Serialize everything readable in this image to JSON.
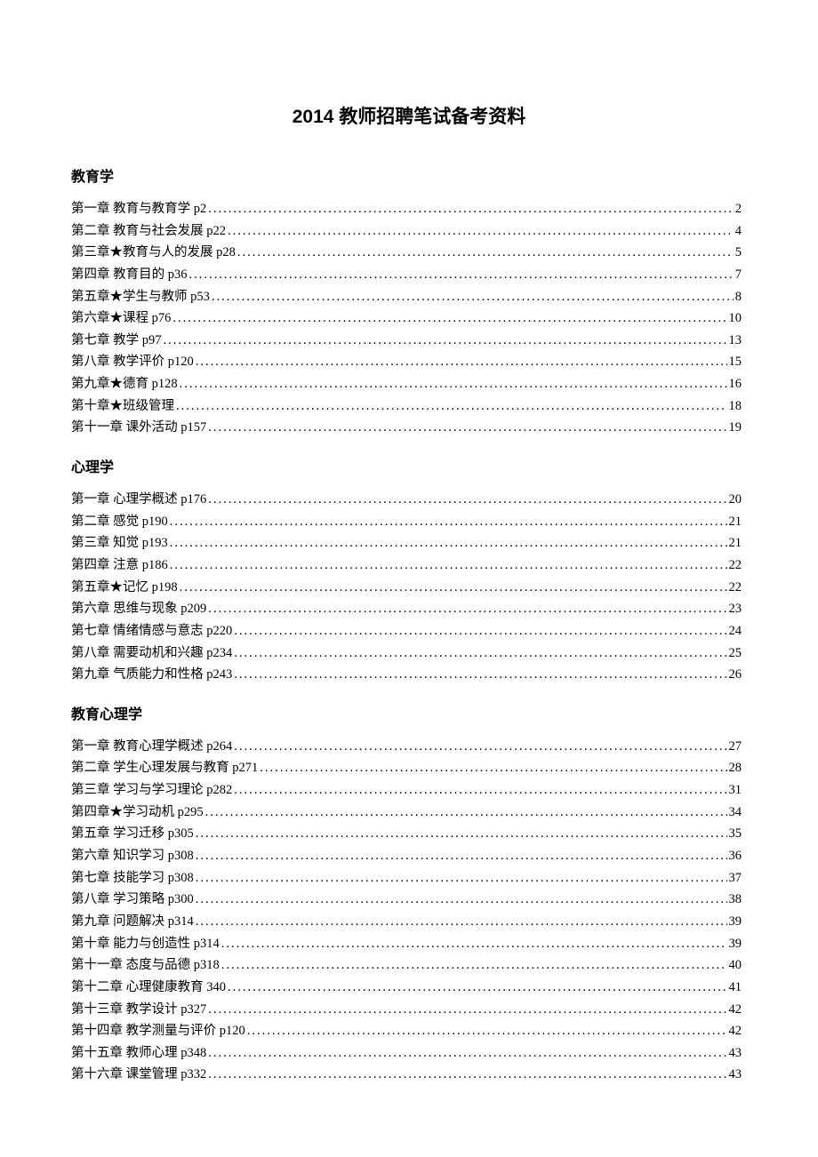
{
  "title": "2014 教师招聘笔试备考资料",
  "sections": [
    {
      "heading": "教育学",
      "items": [
        {
          "label": "第一章  教育与教育学 p2",
          "page": "2"
        },
        {
          "label": "第二章  教育与社会发展 p22",
          "page": "4"
        },
        {
          "label": "第三章★教育与人的发展 p28",
          "page": "5"
        },
        {
          "label": "第四章  教育目的 p36",
          "page": "7"
        },
        {
          "label": "第五章★学生与教师 p53",
          "page": "8"
        },
        {
          "label": "第六章★课程 p76",
          "page": "10"
        },
        {
          "label": "第七章  教学 p97",
          "page": "13"
        },
        {
          "label": "第八章  教学评价 p120",
          "page": "15"
        },
        {
          "label": "第九章★德育 p128",
          "page": "16"
        },
        {
          "label": "第十章★班级管理",
          "page": "18"
        },
        {
          "label": "第十一章  课外活动 p157",
          "page": "19"
        }
      ]
    },
    {
      "heading": "心理学",
      "items": [
        {
          "label": "第一章  心理学概述 p176",
          "page": "20"
        },
        {
          "label": "第二章  感觉 p190",
          "page": "21"
        },
        {
          "label": "第三章  知觉 p193",
          "page": "21"
        },
        {
          "label": "第四章  注意 p186",
          "page": "22"
        },
        {
          "label": "第五章★记忆 p198",
          "page": "22"
        },
        {
          "label": "第六章  思维与现象 p209",
          "page": "23"
        },
        {
          "label": "第七章  情绪情感与意志 p220",
          "page": "24"
        },
        {
          "label": "第八章  需要动机和兴趣 p234",
          "page": "25"
        },
        {
          "label": "第九章  气质能力和性格 p243",
          "page": "26"
        }
      ]
    },
    {
      "heading": "教育心理学",
      "items": [
        {
          "label": "第一章   教育心理学概述 p264",
          "page": "27"
        },
        {
          "label": "第二章   学生心理发展与教育 p271",
          "page": "28"
        },
        {
          "label": "第三章   学习与学习理论 p282",
          "page": "31"
        },
        {
          "label": "第四章★学习动机 p295",
          "page": "34"
        },
        {
          "label": "第五章   学习迁移 p305",
          "page": "35"
        },
        {
          "label": "第六章   知识学习 p308",
          "page": "36"
        },
        {
          "label": "第七章   技能学习 p308",
          "page": "37"
        },
        {
          "label": "第八章   学习策略 p300",
          "page": "38"
        },
        {
          "label": "第九章   问题解决 p314",
          "page": "39"
        },
        {
          "label": "第十章   能力与创造性 p314",
          "page": "39"
        },
        {
          "label": "第十一章  态度与品德 p318",
          "page": "40"
        },
        {
          "label": "第十二章  心理健康教育 340",
          "page": "41"
        },
        {
          "label": "第十三章  教学设计 p327",
          "page": "42"
        },
        {
          "label": "第十四章  教学测量与评价 p120",
          "page": "42"
        },
        {
          "label": "第十五章  教师心理 p348",
          "page": "43"
        },
        {
          "label": "第十六章  课堂管理 p332",
          "page": "43"
        }
      ]
    }
  ]
}
